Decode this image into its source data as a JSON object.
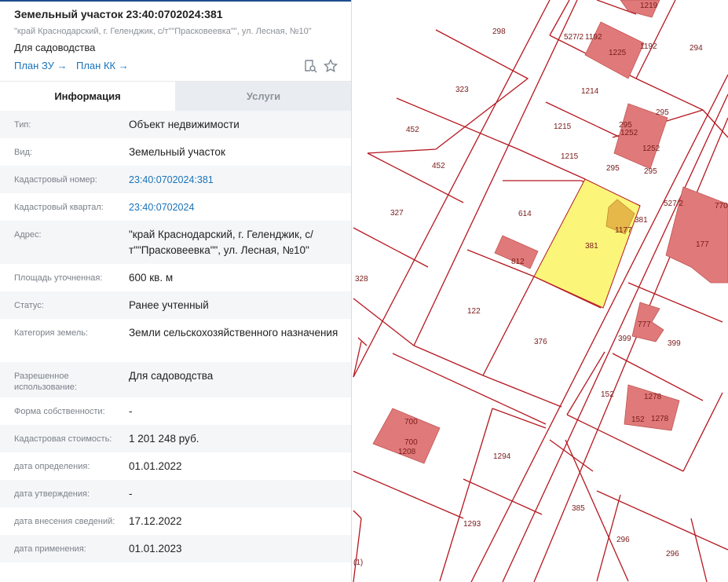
{
  "card": {
    "title": "Земельный участок 23:40:0702024:381",
    "address": "\"край Краснодарский, г. Геленджик, с/т\"\"Прасковеевка\"\", ул. Лесная, №10\"",
    "purpose": "Для садоводства",
    "links": [
      "План ЗУ →",
      "План КК →"
    ],
    "tools": [
      "search-doc-icon",
      "star-icon"
    ]
  },
  "tabs": [
    "Информация",
    "Услуги"
  ],
  "rows": [
    {
      "label": "Тип:",
      "value": "Объект недвижимости",
      "link": false
    },
    {
      "label": "Вид:",
      "value": "Земельный участок",
      "link": false
    },
    {
      "label": "Кадастровый номер:",
      "value": "23:40:0702024:381",
      "link": true
    },
    {
      "label": "Кадастровый квартал:",
      "value": "23:40:0702024",
      "link": true
    },
    {
      "label": "Адрес:",
      "value": "\"край Краснодарский, г. Геленджик, с/т\"\"Прасковеевка\"\", ул. Лесная, №10\"",
      "link": false
    },
    {
      "label": "Площадь уточненная:",
      "value": "600 кв. м",
      "link": false
    },
    {
      "label": "Статус:",
      "value": "Ранее учтенный",
      "link": false
    },
    {
      "label": "Категория земель:",
      "value": "Земли сельскохозяйственного назначения",
      "link": false
    },
    {
      "label": "Разрешенное использование:",
      "value": "Для садоводства",
      "link": false
    },
    {
      "label": "Форма собственности:",
      "value": "-",
      "link": false
    },
    {
      "label": "Кадастровая стоимость:",
      "value": "1 201 248 руб.",
      "link": false
    },
    {
      "label": "дата определения:",
      "value": "01.01.2022",
      "link": false
    },
    {
      "label": "дата утверждения:",
      "value": "-",
      "link": false
    },
    {
      "label": "дата внесения сведений:",
      "value": "17.12.2022",
      "link": false
    },
    {
      "label": "дата применения:",
      "value": "01.01.2023",
      "link": false
    }
  ],
  "map": {
    "colors": {
      "line": "#b5171f",
      "building": "#e07a7a",
      "selected": "#fbf57a",
      "selected_building": "#e6b84a"
    },
    "labels": [
      "298",
      "1219",
      "1192",
      "1225",
      "1192",
      "527/2",
      "294",
      "323",
      "1214",
      "295",
      "1215",
      "1252",
      "1252",
      "295",
      "452",
      "452",
      "1215",
      "295",
      "295",
      "327",
      "614",
      "381",
      "381",
      "1177",
      "527/2",
      "770",
      "812",
      "177",
      "328",
      "381",
      "122",
      "777",
      "399",
      "399",
      "376",
      "152",
      "1278",
      "152",
      "1278",
      "700",
      "700",
      "1208",
      "1294",
      "385",
      "1293",
      "296",
      "296",
      "(1)"
    ]
  }
}
